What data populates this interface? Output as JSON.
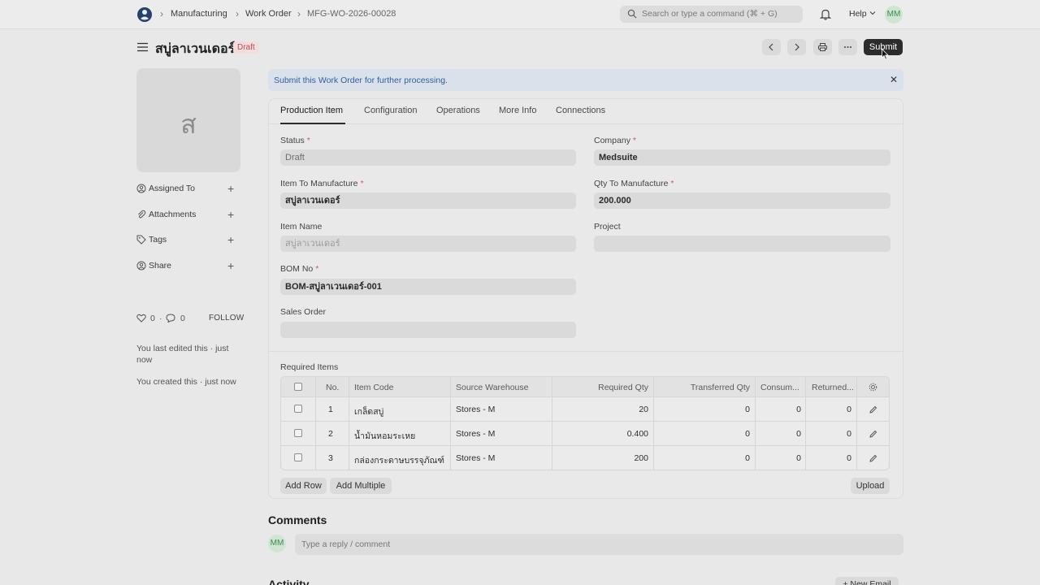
{
  "navbar": {
    "breadcrumbs": [
      "Manufacturing",
      "Work Order",
      "MFG-WO-2026-00028"
    ],
    "search_placeholder": "Search or type a command (⌘ + G)",
    "help_label": "Help",
    "user_initials": "MM"
  },
  "header": {
    "title": "สบู่ลาเวนเดอร์",
    "status_badge": "Draft",
    "submit_label": "Submit"
  },
  "sidebar": {
    "image_letter": "ส",
    "items": [
      {
        "label": "Assigned To",
        "icon": "assign-icon"
      },
      {
        "label": "Attachments",
        "icon": "paperclip-icon"
      },
      {
        "label": "Tags",
        "icon": "tag-icon"
      },
      {
        "label": "Share",
        "icon": "share-icon"
      }
    ],
    "likes_count": "0",
    "comments_count": "0",
    "follow_label": "FOLLOW",
    "last_edited": "You last edited this · just now",
    "created": "You created this · just now"
  },
  "alert": {
    "message": "Submit this Work Order for further processing."
  },
  "tabs": [
    "Production Item",
    "Configuration",
    "Operations",
    "More Info",
    "Connections"
  ],
  "form": {
    "status": {
      "label": "Status",
      "value": "Draft"
    },
    "company": {
      "label": "Company",
      "value": "Medsuite"
    },
    "item_to_manufacture": {
      "label": "Item To Manufacture",
      "value": "สบู่ลาเวนเดอร์"
    },
    "qty_to_manufacture": {
      "label": "Qty To Manufacture",
      "value": "200.000"
    },
    "item_name": {
      "label": "Item Name",
      "value": "สบู่ลาเวนเดอร์"
    },
    "project": {
      "label": "Project",
      "value": ""
    },
    "bom_no": {
      "label": "BOM No",
      "value": "BOM-สบู่ลาเวนเดอร์-001"
    },
    "sales_order": {
      "label": "Sales Order",
      "value": ""
    }
  },
  "required_items": {
    "title": "Required Items",
    "columns": [
      "No.",
      "Item Code",
      "Source Warehouse",
      "Required Qty",
      "Transferred Qty",
      "Consum...",
      "Returned..."
    ],
    "rows": [
      {
        "no": "1",
        "item_code": "เกล็ดสบู่",
        "warehouse": "Stores - M",
        "required": "20",
        "transferred": "0",
        "consumed": "0",
        "returned": "0"
      },
      {
        "no": "2",
        "item_code": "น้ำมันหอมระเหย",
        "warehouse": "Stores - M",
        "required": "0.400",
        "transferred": "0",
        "consumed": "0",
        "returned": "0"
      },
      {
        "no": "3",
        "item_code": "กล่องกระดาษบรรจุภัณฑ์",
        "warehouse": "Stores - M",
        "required": "200",
        "transferred": "0",
        "consumed": "0",
        "returned": "0"
      }
    ],
    "add_row_label": "Add Row",
    "add_multiple_label": "Add Multiple",
    "upload_label": "Upload"
  },
  "comments": {
    "title": "Comments",
    "user_initials": "MM",
    "placeholder": "Type a reply / comment"
  },
  "activity": {
    "title": "Activity",
    "new_email_label": "+ New Email"
  },
  "colors": {
    "draft_badge_text": "#c24f4f",
    "alert_text": "#2c5fa3",
    "submit_bg": "#2c2c2c",
    "avatar_text": "#3d8a52"
  }
}
